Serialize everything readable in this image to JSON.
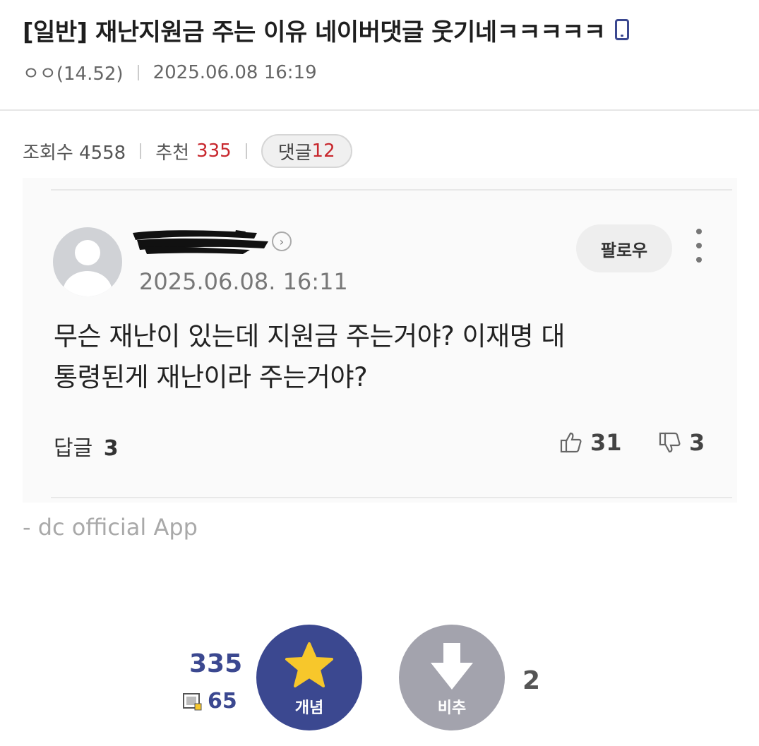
{
  "post": {
    "title": "[일반] 재난지원금 주는 이유 네이버댓글 웃기네ㅋㅋㅋㅋㅋ",
    "author": "ㅇㅇ(14.52)",
    "date": "2025.06.08 16:19",
    "views_label": "조회수 4558",
    "recommend_label": "추천",
    "recommend_value": "335",
    "comment_label": "댓글",
    "comment_count": "12"
  },
  "captured_comment": {
    "date": "2025.06.08. 16:11",
    "follow_label": "팔로우",
    "text_line1": "무슨 재난이 있는데 지원금 주는거야? 이재명 대",
    "text_line2": "통령된게 재난이라 주는거야?",
    "reply_label": "답글",
    "reply_count": "3",
    "likes": "31",
    "dislikes": "3"
  },
  "footer": {
    "source": "- dc official App"
  },
  "vote": {
    "recommend_total": "335",
    "fixed_count": "65",
    "up_label": "개념",
    "down_label": "비추",
    "down_count": "2"
  },
  "colors": {
    "accent": "#3b4890",
    "highlight": "#c8282e",
    "down_button": "#a3a3ad",
    "star": "#f7c72b"
  },
  "icons": [
    "mobile-icon",
    "chevron-right-icon",
    "more-vertical-icon",
    "thumbs-up-icon",
    "thumbs-down-icon",
    "star-icon",
    "arrow-down-icon",
    "fixed-nick-icon"
  ]
}
